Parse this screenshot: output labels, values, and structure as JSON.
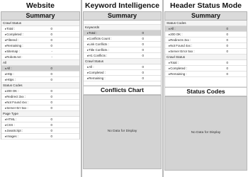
{
  "website": {
    "title": "Website",
    "summary": "Summary",
    "sections": [
      {
        "heading": "Crawl Status",
        "rows": [
          {
            "label": "Total :",
            "value": "0"
          },
          {
            "label": "Completed :",
            "value": "0"
          },
          {
            "label": "Filtered :",
            "value": "0"
          },
          {
            "label": "Remaining :",
            "value": "0"
          },
          {
            "label": "Sitemap :",
            "value": "-"
          },
          {
            "label": "Robots.txt :",
            "value": "-"
          }
        ]
      },
      {
        "heading": "All",
        "rows": [
          {
            "label": "All :",
            "value": "0",
            "selected": true
          },
          {
            "label": "Http :",
            "value": "0"
          },
          {
            "label": "Https :",
            "value": "0"
          }
        ]
      },
      {
        "heading": "Status Codes",
        "rows": [
          {
            "label": "200 OK :",
            "value": "0"
          },
          {
            "label": "Redirect 3xx :",
            "value": "0"
          },
          {
            "label": "Not Found 4xx :",
            "value": "0"
          },
          {
            "label": "Server Err 5xx :",
            "value": "0"
          }
        ]
      },
      {
        "heading": "Page Type",
        "rows": [
          {
            "label": "HTML :",
            "value": "0"
          },
          {
            "label": "CSS :",
            "value": "0"
          },
          {
            "label": "JavaScript :",
            "value": "0"
          },
          {
            "label": "Images :",
            "value": "0"
          }
        ]
      }
    ]
  },
  "keyword": {
    "title": "Keyword Intelligence",
    "summary": "Summary",
    "sections": [
      {
        "heading": "Keywords",
        "rows": [
          {
            "label": "Total :",
            "value": "0",
            "selected": true
          },
          {
            "label": "Conflicts Count :",
            "value": "0"
          },
          {
            "label": "Link Conflicts :",
            "value": "0"
          },
          {
            "label": "Title Conflicts :",
            "value": "0"
          },
          {
            "label": "H1 Conflicts :",
            "value": "0"
          }
        ]
      },
      {
        "heading": "Crawl Status",
        "rows": [
          {
            "label": "All :",
            "value": "0"
          },
          {
            "label": "Completed :",
            "value": "0"
          },
          {
            "label": "Remaining :",
            "value": "0"
          }
        ]
      }
    ],
    "chart_title": "Conflicts Chart",
    "no_data": "No Data for Display"
  },
  "header_status": {
    "title": "Header Status Mode",
    "summary": "Summary",
    "sections": [
      {
        "heading": "Status Codes",
        "rows": [
          {
            "label": "All :",
            "value": "0",
            "selected": true
          },
          {
            "label": "200 OK :",
            "value": "0"
          },
          {
            "label": "Redirects 3xx :",
            "value": "0"
          },
          {
            "label": "Not Found 4xx :",
            "value": "0"
          },
          {
            "label": "Server Error 5xx :",
            "value": "0"
          }
        ]
      },
      {
        "heading": "Crawl Status",
        "rows": [
          {
            "label": "Total :",
            "value": "0"
          },
          {
            "label": "Completed :",
            "value": "0"
          },
          {
            "label": "Remaining :",
            "value": "0"
          }
        ]
      }
    ],
    "chart_title": "Status Codes",
    "no_data": "No Data for Display"
  }
}
